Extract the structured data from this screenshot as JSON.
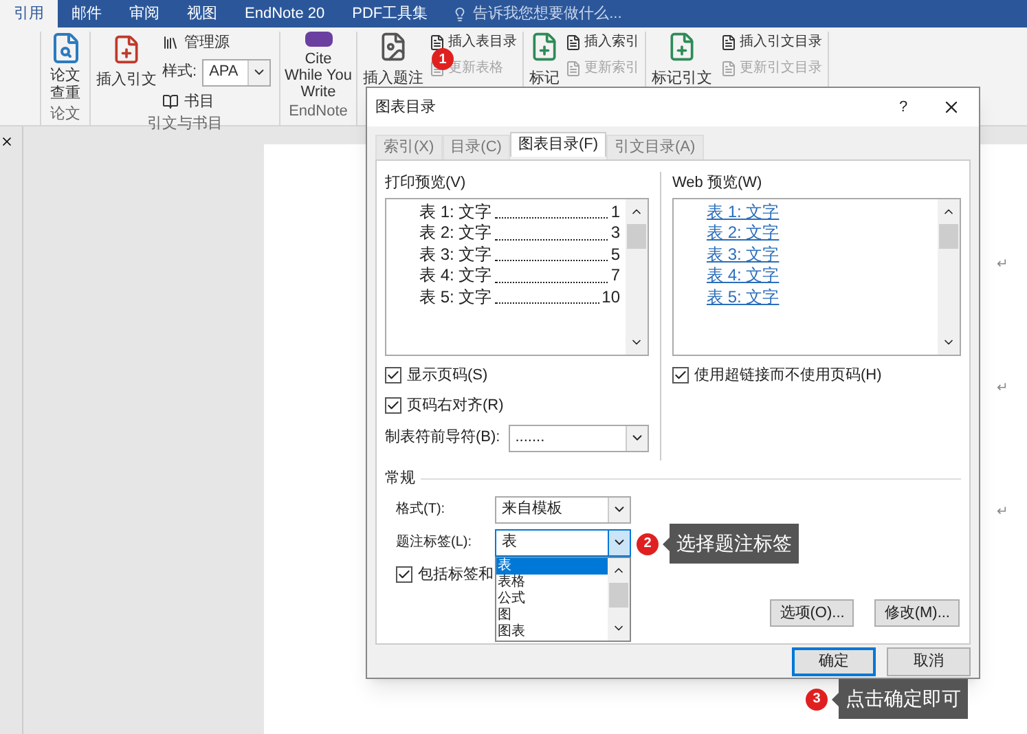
{
  "ribbon": {
    "tabs": [
      {
        "label": "引用",
        "selected": true
      },
      {
        "label": "邮件",
        "selected": false
      },
      {
        "label": "审阅",
        "selected": false
      },
      {
        "label": "视图",
        "selected": false
      },
      {
        "label": "EndNote 20",
        "selected": false
      },
      {
        "label": "PDF工具集",
        "selected": false
      }
    ],
    "search_hint": "告诉我您想要做什么...",
    "thesis_group": {
      "button": "论文查重",
      "label": "论文"
    },
    "citation_group": {
      "insert": "插入引文",
      "manage": "管理源",
      "style_label": "样式:",
      "style_value": "APA",
      "bibliography": "书目",
      "label": "引文与书目"
    },
    "endnote_group": {
      "button": "Cite While You Write",
      "label": "EndNote"
    },
    "caption_group": {
      "insert": "插入题注",
      "items": [
        {
          "label": "插入表目录",
          "disabled": false
        },
        {
          "label": "更新表格",
          "disabled": true
        }
      ]
    },
    "index_group": {
      "mark": "标记",
      "items": [
        {
          "label": "插入索引",
          "disabled": false
        },
        {
          "label": "更新索引",
          "disabled": true
        }
      ]
    },
    "authorities_group": {
      "mark": "标记引文",
      "items": [
        {
          "label": "插入引文目录",
          "disabled": false
        },
        {
          "label": "更新引文目录",
          "disabled": true
        }
      ]
    }
  },
  "document": {
    "paragraph_marks": [
      "↵",
      "↵",
      "↵"
    ]
  },
  "dialog": {
    "title": "图表目录",
    "help": "?",
    "tabs": [
      {
        "label": "索引(X)",
        "selected": false
      },
      {
        "label": "目录(C)",
        "selected": false
      },
      {
        "label": "图表目录(F)",
        "selected": true
      },
      {
        "label": "引文目录(A)",
        "selected": false
      }
    ],
    "print_preview": {
      "label": "打印预览(V)",
      "entries": [
        {
          "label": "表 1: 文字",
          "page": "1"
        },
        {
          "label": "表 2: 文字",
          "page": "3"
        },
        {
          "label": "表 3: 文字",
          "page": "5"
        },
        {
          "label": "表 4: 文字",
          "page": "7"
        },
        {
          "label": "表 5: 文字",
          "page": "10"
        }
      ]
    },
    "web_preview": {
      "label": "Web 预览(W)",
      "entries": [
        "表 1: 文字",
        "表 2: 文字",
        "表 3: 文字",
        "表 4: 文字",
        "表 5: 文字"
      ]
    },
    "show_page_numbers": {
      "label": "显示页码(S)",
      "checked": true
    },
    "right_align": {
      "label": "页码右对齐(R)",
      "checked": true
    },
    "use_hyperlinks": {
      "label": "使用超链接而不使用页码(H)",
      "checked": true
    },
    "tab_leader": {
      "label": "制表符前导符(B):",
      "value": "......."
    },
    "general": {
      "label": "常规",
      "format": {
        "label": "格式(T):",
        "value": "来自模板"
      },
      "caption_label": {
        "label": "题注标签(L):",
        "value": "表",
        "expanded": true,
        "options": [
          {
            "label": "表",
            "selected": true
          },
          {
            "label": "表格",
            "selected": false
          },
          {
            "label": "公式",
            "selected": false
          },
          {
            "label": "图",
            "selected": false
          },
          {
            "label": "图表",
            "selected": false
          }
        ]
      },
      "include_label": {
        "label": "包括标签和",
        "checked": true
      }
    },
    "buttons": [
      {
        "label": "选项(O)..."
      },
      {
        "label": "修改(M)..."
      }
    ],
    "ok": "确定",
    "cancel": "取消"
  },
  "annotations": [
    {
      "number": "1"
    },
    {
      "number": "2",
      "text": "选择题注标签"
    },
    {
      "number": "3",
      "text": "点击确定即可"
    }
  ]
}
